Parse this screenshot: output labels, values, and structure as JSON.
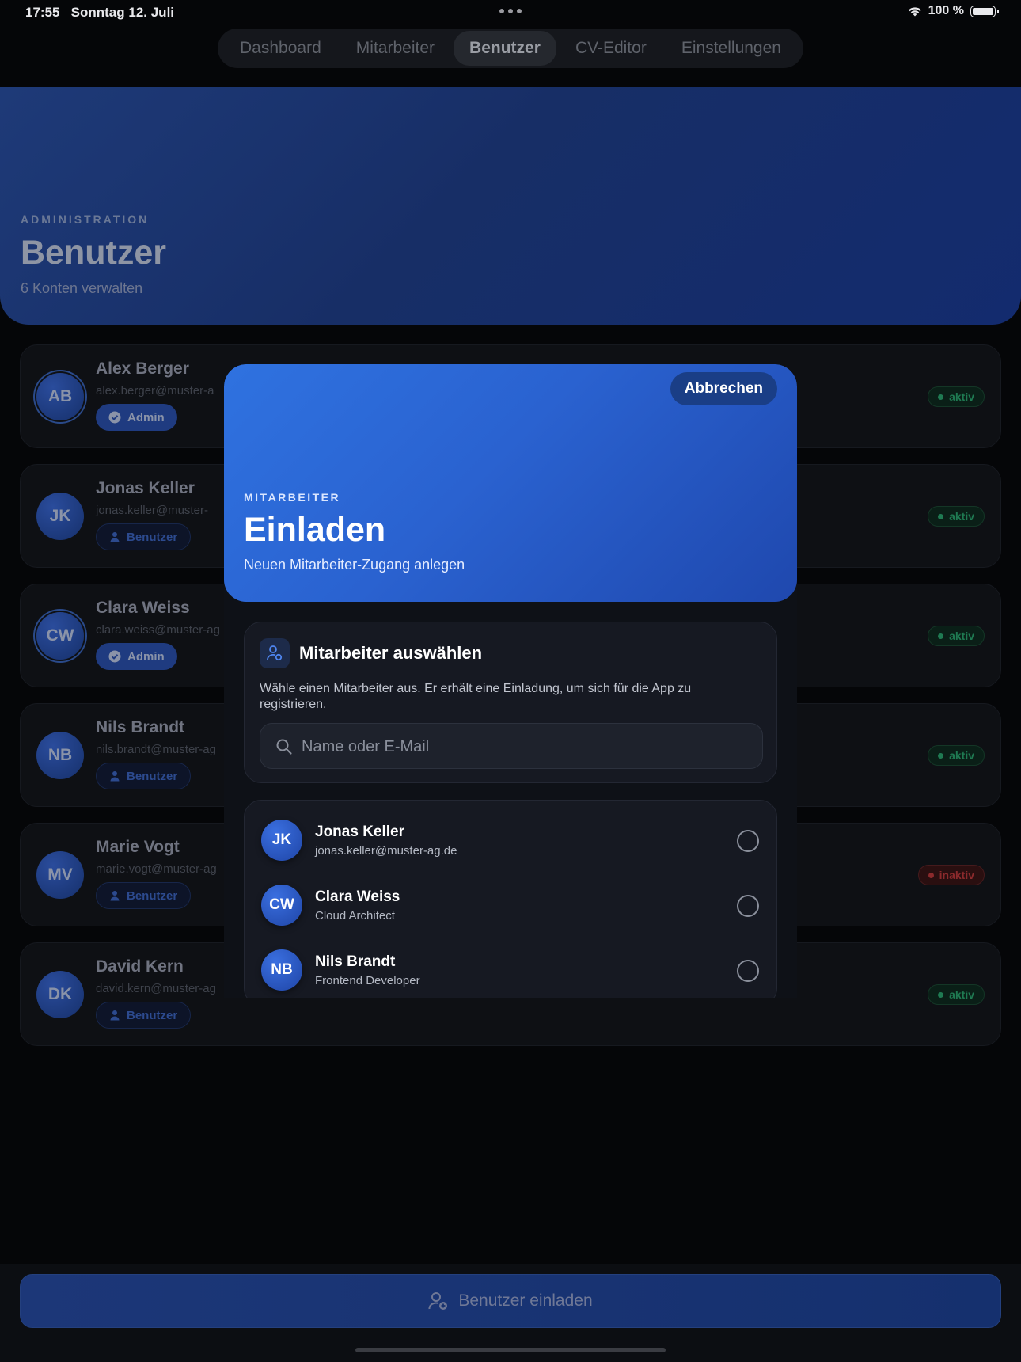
{
  "status_bar": {
    "time": "17:55",
    "date": "Sonntag 12. Juli",
    "battery": "100 %"
  },
  "nav": {
    "tabs": [
      {
        "label": "Dashboard",
        "active": false
      },
      {
        "label": "Mitarbeiter",
        "active": false
      },
      {
        "label": "Benutzer",
        "active": true
      },
      {
        "label": "CV-Editor",
        "active": false
      },
      {
        "label": "Einstellungen",
        "active": false
      }
    ]
  },
  "hero": {
    "eyebrow": "ADMINISTRATION",
    "title": "Benutzer",
    "subtitle": "6 Konten verwalten"
  },
  "users": [
    {
      "initials": "AB",
      "name": "Alex Berger",
      "email": "alex.berger@muster-a",
      "role": "Admin",
      "role_type": "admin",
      "status": "aktiv",
      "status_type": "active"
    },
    {
      "initials": "JK",
      "name": "Jonas Keller",
      "email": "jonas.keller@muster-",
      "role": "Benutzer",
      "role_type": "user",
      "status": "aktiv",
      "status_type": "active"
    },
    {
      "initials": "CW",
      "name": "Clara Weiss",
      "email": "clara.weiss@muster-ag",
      "role": "Admin",
      "role_type": "admin",
      "status": "aktiv",
      "status_type": "active"
    },
    {
      "initials": "NB",
      "name": "Nils Brandt",
      "email": "nils.brandt@muster-ag",
      "role": "Benutzer",
      "role_type": "user",
      "status": "aktiv",
      "status_type": "active"
    },
    {
      "initials": "MV",
      "name": "Marie Vogt",
      "email": "marie.vogt@muster-ag",
      "role": "Benutzer",
      "role_type": "user",
      "status": "inaktiv",
      "status_type": "inactive"
    },
    {
      "initials": "DK",
      "name": "David Kern",
      "email": "david.kern@muster-ag",
      "role": "Benutzer",
      "role_type": "user",
      "status": "aktiv",
      "status_type": "active"
    }
  ],
  "bottom": {
    "invite_label": "Benutzer einladen"
  },
  "modal": {
    "cancel_label": "Abbrechen",
    "eyebrow": "MITARBEITER",
    "title": "Einladen",
    "subtitle": "Neuen Mitarbeiter-Zugang anlegen",
    "select": {
      "title": "Mitarbeiter auswählen",
      "description": "Wähle einen Mitarbeiter aus. Er erhält eine Einladung, um sich für die App zu registrieren.",
      "search_placeholder": "Name oder E-Mail",
      "search_value": ""
    },
    "employees": [
      {
        "initials": "JK",
        "name": "Jonas Keller",
        "subtitle": "jonas.keller@muster-ag.de",
        "selected": false
      },
      {
        "initials": "CW",
        "name": "Clara Weiss",
        "subtitle": "Cloud Architect",
        "selected": false
      },
      {
        "initials": "NB",
        "name": "Nils Brandt",
        "subtitle": "Frontend Developer",
        "selected": false
      }
    ]
  },
  "colors": {
    "accent": "#2f72e0",
    "active_status": "#1f7a52",
    "inactive_status": "#8c2a2c",
    "background": "#050608"
  },
  "icons": {
    "admin_badge": "verified-check-icon",
    "user_badge": "person-icon",
    "invite": "person-add-icon",
    "search": "search-icon",
    "wifi": "wifi-icon",
    "battery": "battery-icon"
  }
}
